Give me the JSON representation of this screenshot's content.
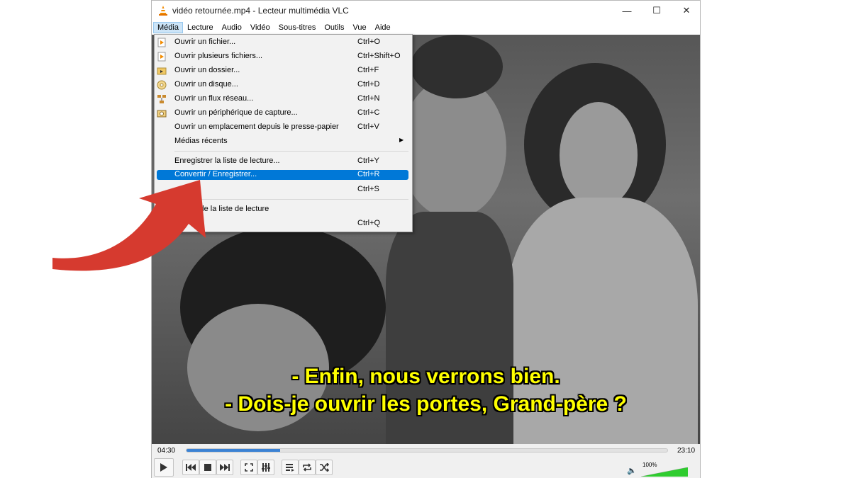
{
  "window": {
    "title": "vidéo retournée.mp4 - Lecteur multimédia VLC",
    "controls": [
      "—",
      "☐",
      "✕"
    ]
  },
  "menubar": [
    "Média",
    "Lecture",
    "Audio",
    "Vidéo",
    "Sous-titres",
    "Outils",
    "Vue",
    "Aide"
  ],
  "media_menu": {
    "items": [
      {
        "label": "Ouvrir un fichier...",
        "shortcut": "Ctrl+O",
        "icon": "file-play-icon"
      },
      {
        "label": "Ouvrir plusieurs fichiers...",
        "shortcut": "Ctrl+Shift+O",
        "icon": "files-play-icon"
      },
      {
        "label": "Ouvrir un dossier...",
        "shortcut": "Ctrl+F",
        "icon": "folder-icon"
      },
      {
        "label": "Ouvrir un disque...",
        "shortcut": "Ctrl+D",
        "icon": "disc-icon"
      },
      {
        "label": "Ouvrir un flux réseau...",
        "shortcut": "Ctrl+N",
        "icon": "network-icon"
      },
      {
        "label": "Ouvrir un périphérique de capture...",
        "shortcut": "Ctrl+C",
        "icon": "capture-device-icon"
      },
      {
        "label": "Ouvrir un emplacement depuis le presse-papier",
        "shortcut": "Ctrl+V",
        "icon": ""
      },
      {
        "label": "Médias récents",
        "shortcut": "",
        "icon": "",
        "submenu": true
      },
      {
        "label": "Enregistrer la liste de lecture...",
        "shortcut": "Ctrl+Y",
        "icon": ""
      },
      {
        "label": "Convertir / Enregistrer...",
        "shortcut": "Ctrl+R",
        "icon": "",
        "highlighted": true
      },
      {
        "label": "...er...",
        "shortcut": "Ctrl+S",
        "icon": ""
      },
      {
        "label": "à la fin de la liste de lecture",
        "shortcut": "",
        "icon": ""
      },
      {
        "label": "",
        "shortcut": "Ctrl+Q",
        "icon": ""
      }
    ]
  },
  "video": {
    "subtitle_line1": "- Enfin, nous verrons bien.",
    "subtitle_line2": "- Dois-je ouvrir les portes, Grand-père ?"
  },
  "player": {
    "elapsed": "04:30",
    "total": "23:10",
    "progress": 0.195,
    "volume_label": "100%",
    "volume": 1.0,
    "buttons": [
      "play-icon",
      "previous-icon",
      "stop-icon",
      "next-icon",
      "fullscreen-icon",
      "extended-settings-icon",
      "playlist-icon",
      "loop-icon",
      "shuffle-icon"
    ]
  },
  "colors": {
    "highlight": "#0078d7",
    "seek_fill": "#3b82d4",
    "arrow": "#d63a2f",
    "subtitle": "#ffff00"
  }
}
